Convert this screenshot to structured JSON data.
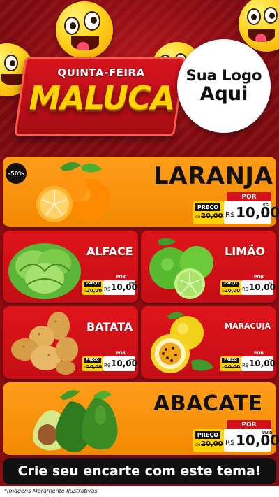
{
  "header": {
    "title_small": "QUINTA-FEIRA",
    "title_big": "MALUCA",
    "logo_line1": "Sua Logo",
    "logo_line2": "Aqui"
  },
  "products": [
    {
      "name": "LARANJA",
      "discount": "-50%",
      "price_label": "PREÇO",
      "de": "de",
      "old": "20,00",
      "por": "POR",
      "currency": "R$",
      "price": "10,00",
      "unit": "KG"
    },
    {
      "name": "ALFACE",
      "price_label": "PREÇO",
      "de": "de",
      "old": "20,00",
      "por": "POR",
      "currency": "R$",
      "price": "10,00",
      "unit": "UNID"
    },
    {
      "name": "LIMÃO",
      "price_label": "PREÇO",
      "de": "de",
      "old": "20,00",
      "por": "POR",
      "currency": "R$",
      "price": "10,00",
      "unit": "KG"
    },
    {
      "name": "BATATA",
      "price_label": "PREÇO",
      "de": "de",
      "old": "20,00",
      "por": "POR",
      "currency": "R$",
      "price": "10,00",
      "unit": "UNID"
    },
    {
      "name": "MARACUJÁ",
      "price_label": "PREÇO",
      "de": "de",
      "old": "20,00",
      "por": "POR",
      "currency": "R$",
      "price": "10,00",
      "unit": "KG"
    },
    {
      "name": "ABACATE",
      "price_label": "PREÇO",
      "de": "de",
      "old": "20,00",
      "por": "POR",
      "currency": "R$",
      "price": "10,00",
      "unit": "UNID"
    }
  ],
  "cta": "Crie seu encarte com este tema!",
  "footnote": "*Imagens Meramente Ilustrativas",
  "colors": {
    "header_red": "#b3151c",
    "card_orange": "#f28a00",
    "card_red": "#d3111a",
    "tag_yellow": "#ffd400"
  },
  "icons": [
    "emoji-face-icon",
    "orange-fruit-icon",
    "lettuce-icon",
    "lime-icon",
    "potato-icon",
    "passion-fruit-icon",
    "avocado-icon"
  ]
}
